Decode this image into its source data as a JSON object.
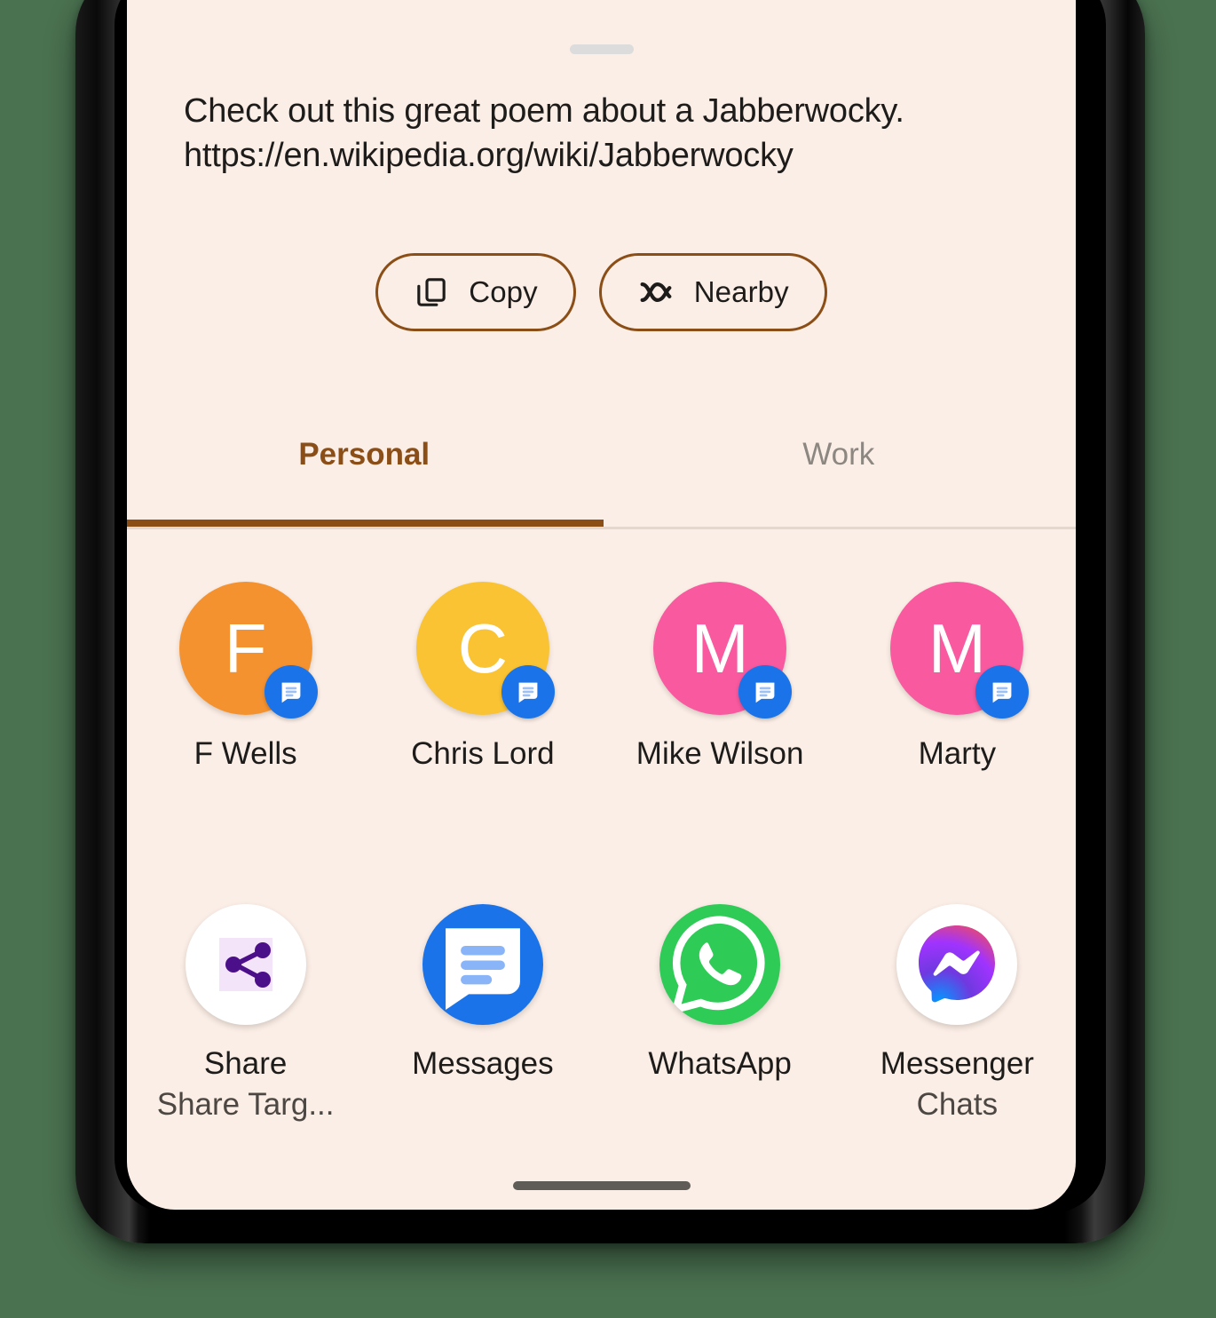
{
  "colors": {
    "page_background": "#4a7150",
    "sheet_background": "#fbeee6",
    "accent_brown": "#8a4e16",
    "text_primary": "#1d1c1a",
    "tab_inactive": "#8c8781",
    "badge_blue": "#1a73e8"
  },
  "share_sheet": {
    "drag_handle": "drag-handle",
    "share_text": {
      "line1": "Check out this great poem about a Jabberwocky.",
      "line2": "https://en.wikipedia.org/wiki/Jabberwocky"
    },
    "actions": [
      {
        "label": "Copy",
        "icon": "copy-icon"
      },
      {
        "label": "Nearby",
        "icon": "nearby-share-icon"
      }
    ],
    "tabs": [
      {
        "label": "Personal",
        "active": true
      },
      {
        "label": "Work",
        "active": false
      }
    ],
    "contacts": [
      {
        "name": "F Wells",
        "initial": "F",
        "color": "#f59230",
        "badge": "messages-badge-icon"
      },
      {
        "name": "Chris Lord",
        "initial": "C",
        "color": "#f9c333",
        "badge": "messages-badge-icon"
      },
      {
        "name": "Mike Wilson",
        "initial": "M",
        "color": "#f9599f",
        "badge": "messages-badge-icon"
      },
      {
        "name": "Marty",
        "initial": "M",
        "color": "#f9599f",
        "badge": "messages-badge-icon"
      }
    ],
    "apps": [
      {
        "name": "Share",
        "subtitle": "Share Targ...",
        "icon": "share-nodes-icon"
      },
      {
        "name": "Messages",
        "subtitle": "",
        "icon": "google-messages-icon"
      },
      {
        "name": "WhatsApp",
        "subtitle": "",
        "icon": "whatsapp-icon"
      },
      {
        "name": "Messenger",
        "subtitle": "Chats",
        "icon": "facebook-messenger-icon"
      }
    ],
    "gesture_bar": "gesture-navigation-bar"
  }
}
